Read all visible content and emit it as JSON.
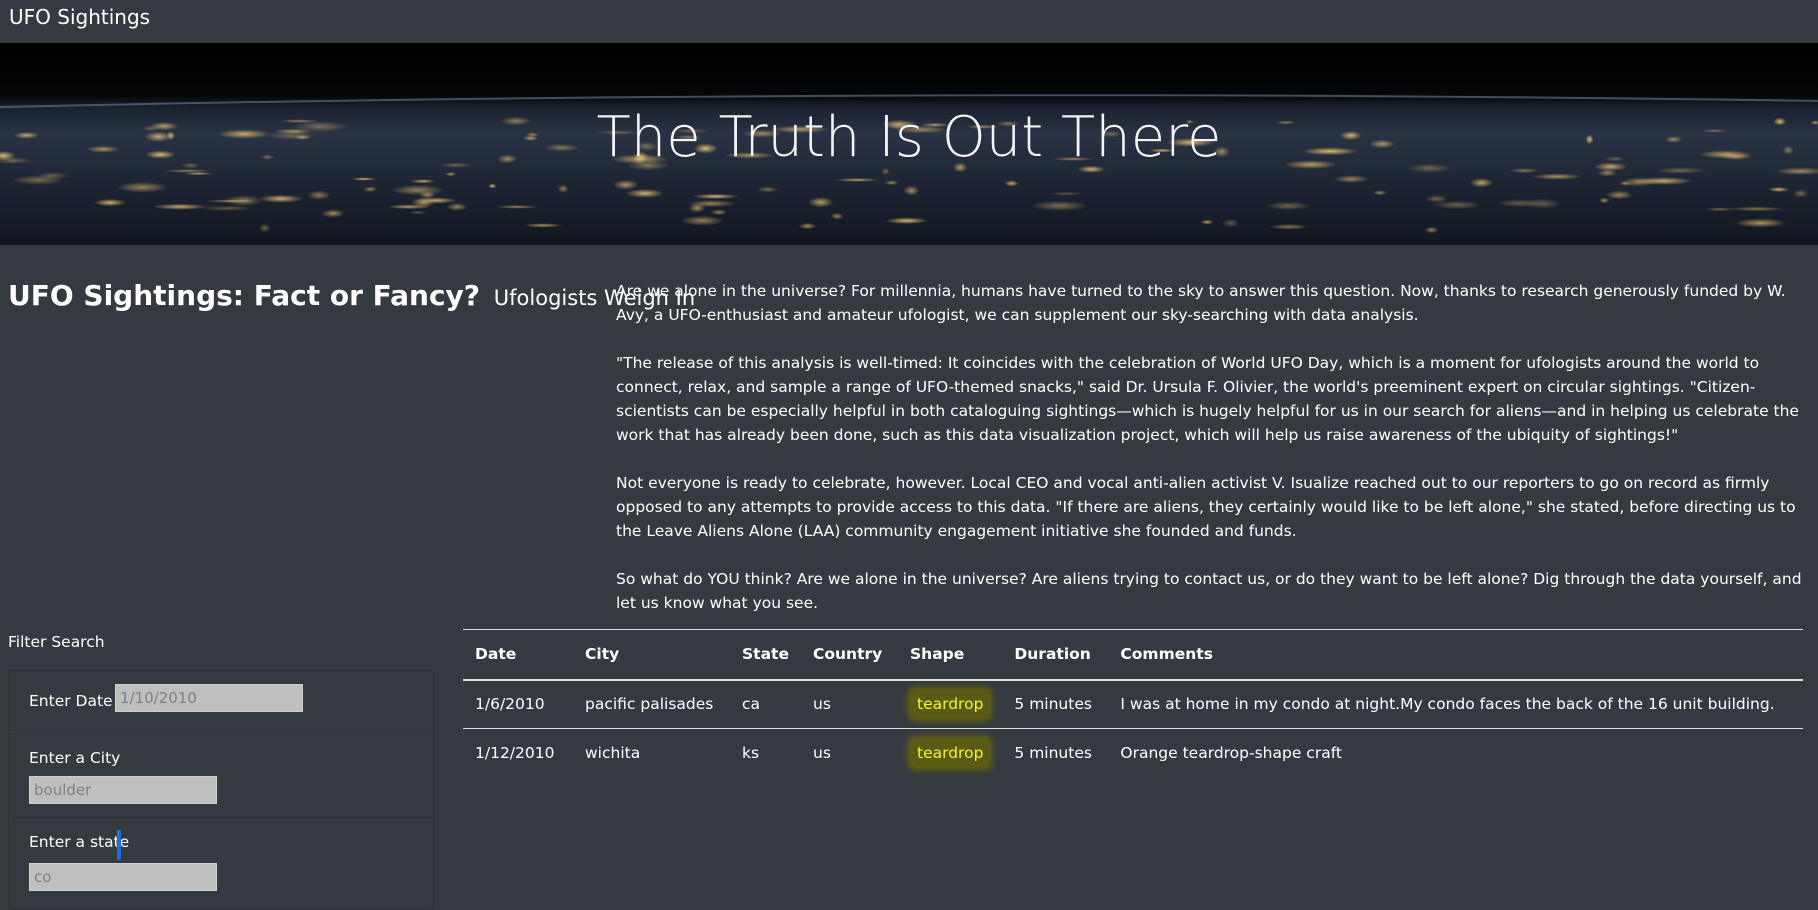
{
  "navbar": {
    "brand": "UFO Sightings"
  },
  "hero": {
    "title": "The Truth Is Out There"
  },
  "intro": {
    "title": "UFO Sightings: Fact or Fancy?",
    "subtitle": "Ufologists Weigh In",
    "paragraphs": [
      "Are we alone in the universe? For millennia, humans have turned to the sky to answer this question. Now, thanks to research generously funded by W. Avy, a UFO-enthusiast and amateur ufologist, we can supplement our sky-searching with data analysis.",
      "\"The release of this analysis is well-timed: It coincides with the celebration of World UFO Day, which is a moment for ufologists around the world to connect, relax, and sample a range of UFO-themed snacks,\" said Dr. Ursula F. Olivier, the world's preeminent expert on circular sightings. \"Citizen-scientists can be especially helpful in both cataloguing sightings—which is hugely helpful for us in our search for aliens—and in helping us celebrate the work that has already been done, such as this data visualization project, which will help us raise awareness of the ubiquity of sightings!\"",
      "Not everyone is ready to celebrate, however. Local CEO and vocal anti-alien activist V. Isualize reached out to our reporters to go on record as firmly opposed to any attempts to provide access to this data. \"If there are aliens, they certainly would like to be left alone,\" she stated, before directing us to the Leave Aliens Alone (LAA) community engagement initiative she founded and funds.",
      "So what do YOU think? Are we alone in the universe? Are aliens trying to contact us, or do they want to be left alone? Dig through the data yourself, and let us know what you see."
    ]
  },
  "filters": {
    "heading": "Filter Search",
    "date": {
      "label": "Enter Date",
      "placeholder": "1/10/2010",
      "value": ""
    },
    "city": {
      "label": "Enter a City",
      "placeholder": "boulder",
      "value": ""
    },
    "state": {
      "label": "Enter a state",
      "placeholder": "co",
      "value": ""
    }
  },
  "table": {
    "headers": [
      "Date",
      "City",
      "State",
      "Country",
      "Shape",
      "Duration",
      "Comments"
    ],
    "rows": [
      [
        "1/6/2010",
        "pacific palisades",
        "ca",
        "us",
        "teardrop",
        "5 minutes",
        "I was at home in my condo at night.My condo faces the back of the 16 unit building."
      ],
      [
        "1/12/2010",
        "wichita",
        "ks",
        "us",
        "teardrop",
        "5 minutes",
        "Orange teardrop-shape craft"
      ]
    ]
  },
  "colors": {
    "background": "#343a40",
    "highlight_bg": "#5b5b16",
    "highlight_text": "#f5f52a",
    "cursor": "#1e6fd9"
  }
}
